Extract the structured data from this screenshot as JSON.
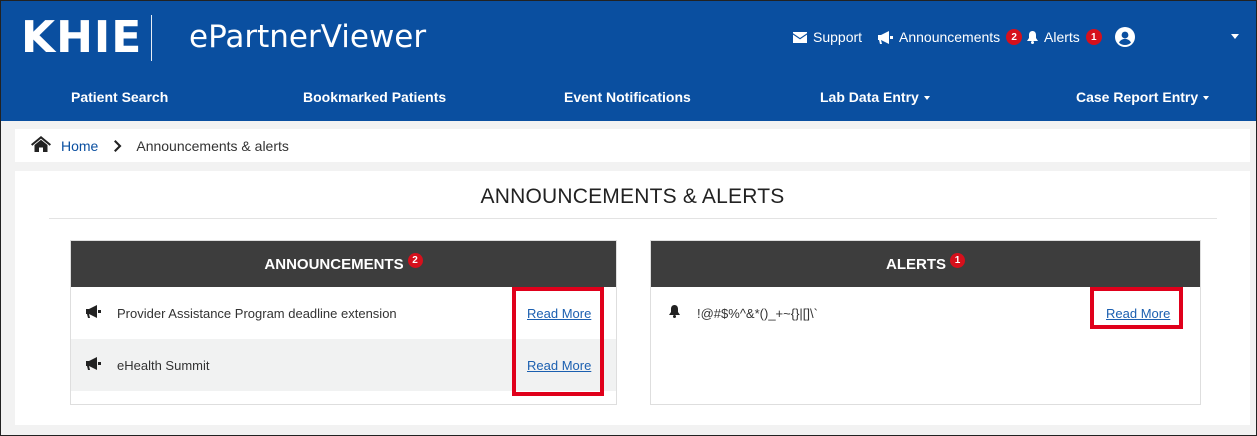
{
  "header": {
    "logo_text": "KHIE",
    "app_title": "ePartnerViewer",
    "support_label": "Support",
    "announcements_label": "Announcements",
    "announcements_count": "2",
    "alerts_label": "Alerts",
    "alerts_count": "1"
  },
  "nav": {
    "items": [
      {
        "label": "Patient Search"
      },
      {
        "label": "Bookmarked Patients"
      },
      {
        "label": "Event Notifications"
      },
      {
        "label": "Lab Data Entry"
      },
      {
        "label": "Case Report Entry"
      }
    ]
  },
  "breadcrumb": {
    "home": "Home",
    "current": "Announcements & alerts"
  },
  "page": {
    "title": "ANNOUNCEMENTS & ALERTS"
  },
  "announcements": {
    "title": "ANNOUNCEMENTS",
    "count": "2",
    "items": [
      {
        "text": "Provider Assistance Program deadline extension",
        "link": "Read More"
      },
      {
        "text": "eHealth Summit",
        "link": "Read More"
      }
    ]
  },
  "alerts": {
    "title": "ALERTS",
    "count": "1",
    "items": [
      {
        "text": "!@#$%^&*()_+~{}|[]\\`",
        "link": "Read More"
      }
    ]
  },
  "colors": {
    "brand_blue": "#0a4fa0",
    "panel_header": "#3d3d3d",
    "badge_red": "#d6101c",
    "highlight_red": "#e0001b",
    "link_blue": "#1b5fb0"
  },
  "icons": {
    "support": "envelope-icon",
    "announcements": "megaphone-icon",
    "alerts": "bell-icon",
    "account": "user-circle-icon",
    "home": "home-icon",
    "separator": "chevron-right-icon"
  }
}
